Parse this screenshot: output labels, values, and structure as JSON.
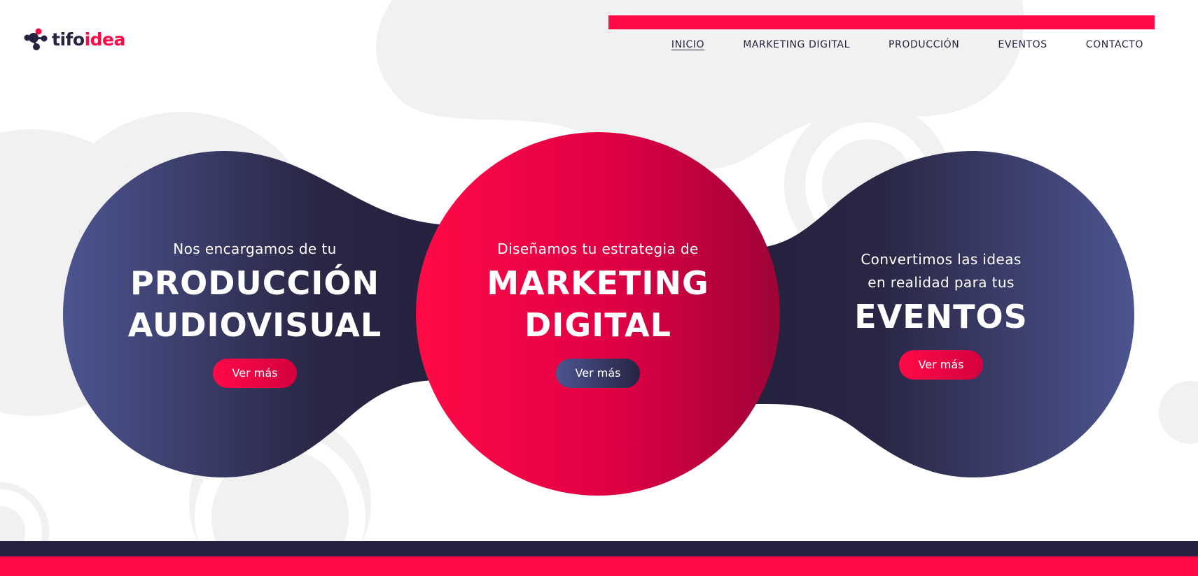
{
  "brand": {
    "logo_part_a": "tifo",
    "logo_part_b": "idea",
    "colors": {
      "accent": "#ff0a47",
      "navy": "#25233f",
      "indigo": "#4c5590",
      "background_blob": "#f1f1f1"
    },
    "logo_icon": "molecule-icon"
  },
  "nav": {
    "items": [
      {
        "label": "INICIO",
        "active": true
      },
      {
        "label": "MARKETING DIGITAL",
        "active": false
      },
      {
        "label": "PRODUCCIÓN",
        "active": false
      },
      {
        "label": "EVENTOS",
        "active": false
      },
      {
        "label": "CONTACTO",
        "active": false
      }
    ]
  },
  "hero": {
    "left": {
      "intro": "Nos encargamos de tu",
      "headline": "PRODUCCIÓN\nAUDIOVISUAL",
      "button": "Ver más"
    },
    "center": {
      "intro": "Diseñamos tu estrategia de",
      "headline": "MARKETING\nDIGITAL",
      "button": "Ver más"
    },
    "right": {
      "intro": "Convertimos las ideas\nen realidad para tus",
      "headline": "EVENTOS",
      "button": "Ver más"
    }
  }
}
